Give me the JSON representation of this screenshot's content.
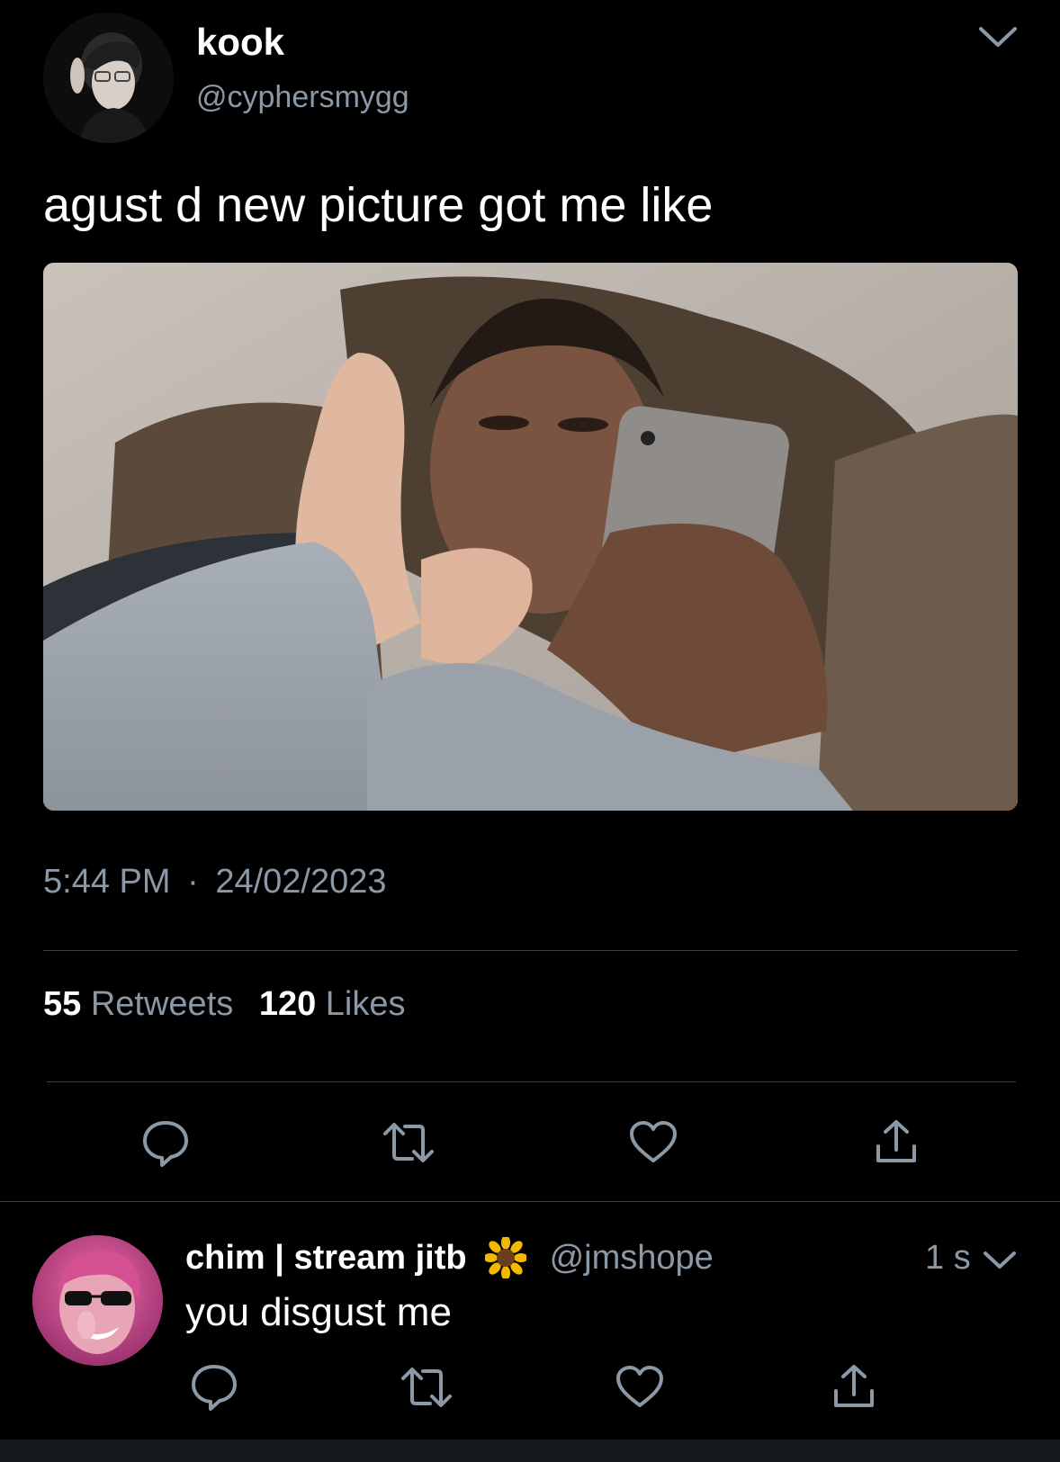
{
  "main_tweet": {
    "display_name": "kook",
    "handle": "@cyphersmygg",
    "text": "agust d new picture got me like",
    "time": "5:44 PM",
    "separator": "·",
    "date": "24/02/2023",
    "retweet_count": "55",
    "retweet_label": "Retweets",
    "like_count": "120",
    "like_label": "Likes"
  },
  "reply": {
    "display_name": "chim | stream jitb",
    "handle": "@jmshope",
    "age": "1 s",
    "text": "you disgust me"
  },
  "icons": {
    "menu": "chevron-down-icon",
    "reply": "reply-icon",
    "retweet": "retweet-icon",
    "like": "heart-icon",
    "share": "share-icon",
    "emoji": "sunflower-icon"
  },
  "colors": {
    "background": "#000000",
    "text": "#ffffff",
    "muted": "#8b98a5",
    "divider": "#38444d"
  }
}
